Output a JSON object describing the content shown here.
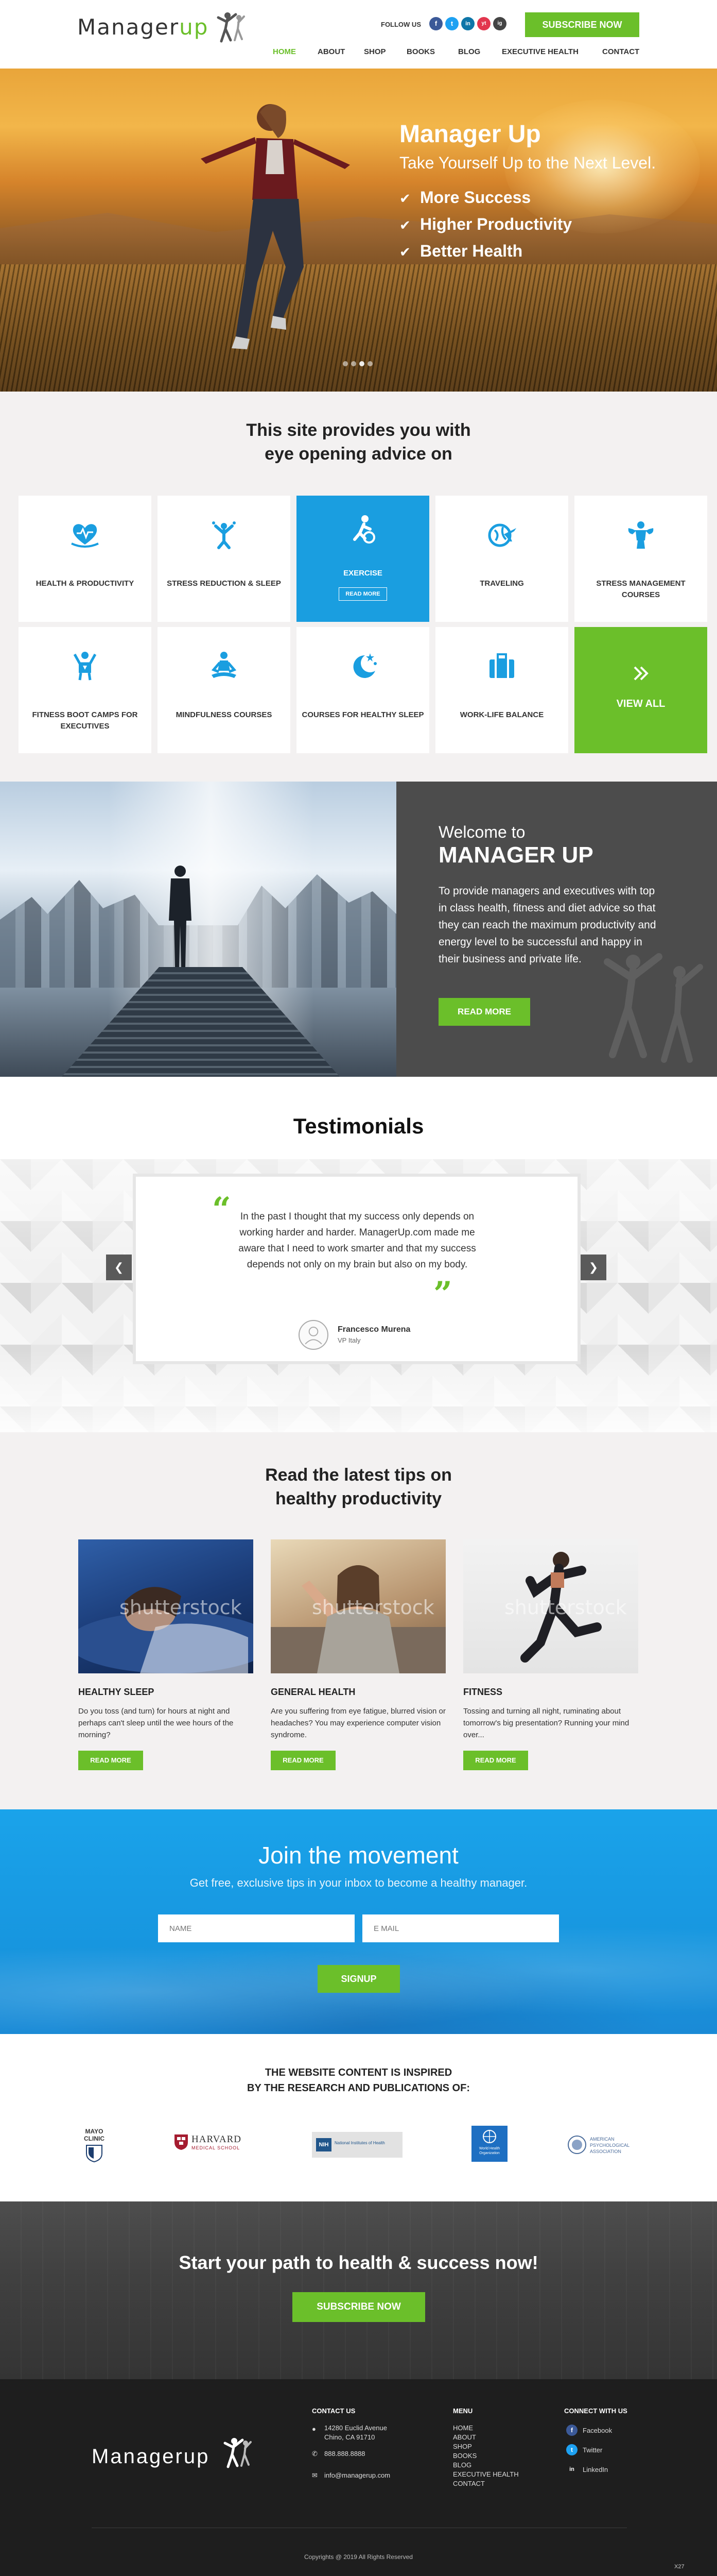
{
  "header": {
    "logo_text": "Managerup",
    "logo_accent": "up",
    "follow_label": "FOLLOW US",
    "social": [
      "f",
      "t",
      "in",
      "yt",
      "ig"
    ],
    "subscribe_label": "SUBSCRIBE NOW",
    "nav": [
      "HOME",
      "ABOUT",
      "SHOP",
      "BOOKS",
      "BLOG",
      "EXECUTIVE HEALTH",
      "CONTACT"
    ],
    "active_nav": "HOME"
  },
  "hero": {
    "title": "Manager Up",
    "subtitle": "Take Yourself Up to the Next Level.",
    "bullets": [
      "More Success",
      "Higher Productivity",
      "Better Health"
    ],
    "slides": 4,
    "active_slide": 3
  },
  "advice": {
    "title_line1": "This site provides you with",
    "title_line2": "eye opening advice on",
    "tiles": [
      {
        "label": "HEALTH & PRODUCTIVITY",
        "icon": "heart-pulse-icon"
      },
      {
        "label": "STRESS REDUCTION & SLEEP",
        "icon": "meditation-arms-up-icon"
      },
      {
        "label": "EXERCISE",
        "icon": "exercise-person-icon",
        "more": "READ MORE"
      },
      {
        "label": "TRAVELING",
        "icon": "globe-plane-icon"
      },
      {
        "label": "STRESS MANAGEMENT COURSES",
        "icon": "muscle-man-icon"
      },
      {
        "label": "FITNESS BOOT CAMPS FOR EXECUTIVES",
        "icon": "fitness-trophy-icon"
      },
      {
        "label": "MINDFULNESS COURSES",
        "icon": "lotus-pose-icon"
      },
      {
        "label": "COURSES FOR HEALTHY SLEEP",
        "icon": "moon-stars-icon"
      },
      {
        "label": "WORK-LIFE BALANCE",
        "icon": "suitcase-icon"
      },
      {
        "label": "VIEW ALL",
        "icon": "double-chevron-icon"
      }
    ]
  },
  "welcome": {
    "small": "Welcome to",
    "big": "MANAGER UP",
    "text": "To provide managers and executives with top in class health, fitness and diet advice so that they can reach the maximum productivity and energy level to be successful and happy in their business and private life.",
    "button": "READ MORE"
  },
  "testimonials": {
    "title": "Testimonials",
    "quote": "In the past I thought that my success only depends on working harder and harder. ManagerUp.com made me aware that I need to work smarter and that my success depends not only on my brain but also on my body.",
    "name": "Francesco Murena",
    "role": "VP Italy",
    "open_quote": "“",
    "close_quote": "”",
    "prev": "❮",
    "next": "❯"
  },
  "tips": {
    "title_line1": "Read the latest tips on",
    "title_line2": "healthy productivity",
    "watermark": "shutterstock",
    "articles": [
      {
        "title": "HEALTHY SLEEP",
        "text": "Do you toss (and turn) for hours at night and perhaps can't sleep until the wee hours of the morning?",
        "button": "READ MORE"
      },
      {
        "title": "GENERAL HEALTH",
        "text": "Are you suffering from eye fatigue, blurred vision or headaches? You may experience computer vision syndrome.",
        "button": "READ MORE"
      },
      {
        "title": "FITNESS",
        "text": "Tossing and turning all night, ruminating about tomorrow's big presentation? Running your mind over...",
        "button": "READ MORE"
      }
    ]
  },
  "join": {
    "title": "Join the movement",
    "subtitle": "Get free, exclusive tips in your inbox to become a healthy manager.",
    "name_placeholder": "NAME",
    "email_placeholder": "E MAIL",
    "button": "SIGNUP"
  },
  "inspired": {
    "title_line1": "THE WEBSITE CONTENT IS INSPIRED",
    "title_line2": "BY THE RESEARCH AND PUBLICATIONS OF:",
    "partners": [
      {
        "name": "MAYO CLINIC",
        "sub": ""
      },
      {
        "name": "HARVARD",
        "sub": "MEDICAL SCHOOL"
      },
      {
        "name": "NIH",
        "sub": "National Institutes of Health"
      },
      {
        "name": "World Health Organization",
        "sub": ""
      },
      {
        "name": "AMERICAN PSYCHOLOGICAL ASSOCIATION",
        "sub": ""
      }
    ]
  },
  "start": {
    "title": "Start your path to health & success now!",
    "button": "SUBSCRIBE NOW"
  },
  "footer": {
    "logo_text": "Managerup",
    "contact_title": "CONTACT US",
    "address_line1": "14280 Euclid Avenue",
    "address_line2": "Chino, CA 91710",
    "phone": "888.888.8888",
    "email": "info@managerup.com",
    "menu_title": "MENU",
    "menu": [
      "HOME",
      "ABOUT",
      "SHOP",
      "BOOKS",
      "BLOG",
      "EXECUTIVE HEALTH",
      "CONTACT"
    ],
    "connect_title": "CONNECT WITH US",
    "connect": [
      {
        "label": "Facebook",
        "icon": "f"
      },
      {
        "label": "Twitter",
        "icon": "t"
      },
      {
        "label": "LinkedIn",
        "icon": "in"
      }
    ],
    "copyright": "Copyrights @ 2019 All Rights Reserved",
    "badge": "X27"
  },
  "colors": {
    "green": "#6bbf2a",
    "blue": "#1a9ee0",
    "dark": "#1e1e1e",
    "gray": "#4c4c4c"
  }
}
